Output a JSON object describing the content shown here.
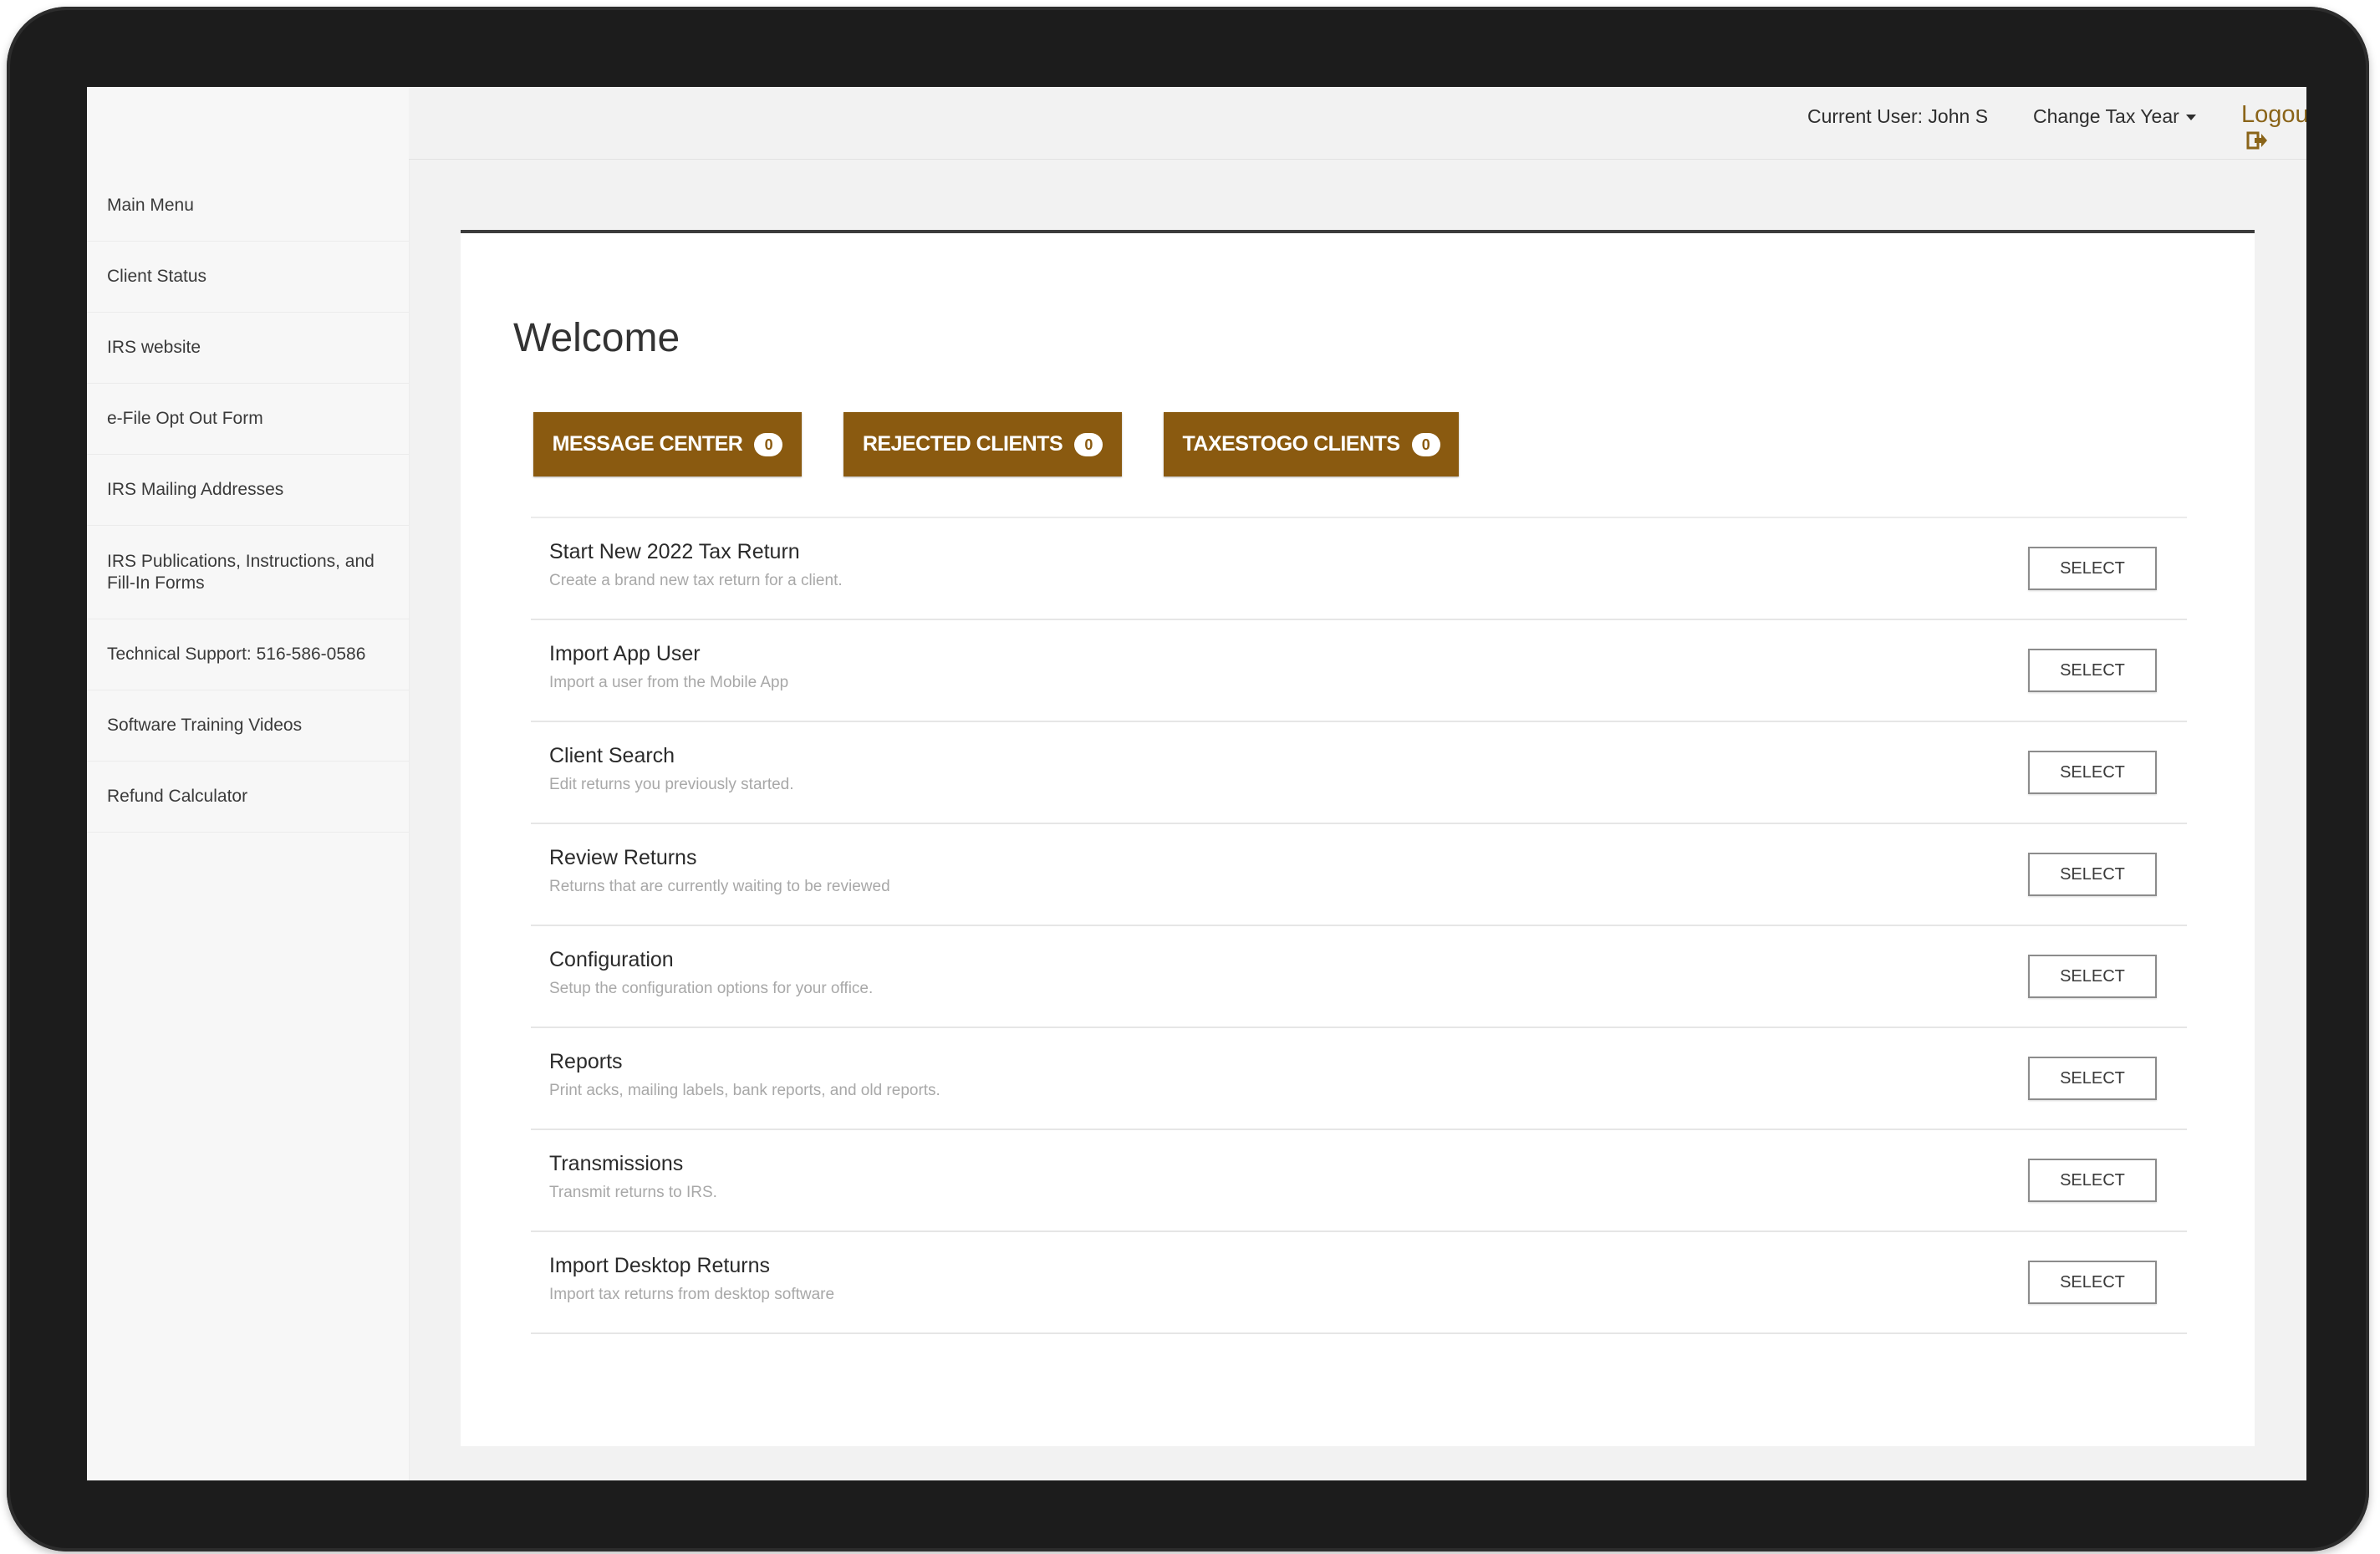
{
  "sidebar": {
    "items": [
      {
        "label": "Main Menu"
      },
      {
        "label": "Client Status"
      },
      {
        "label": "IRS website"
      },
      {
        "label": "e-File Opt Out Form"
      },
      {
        "label": "IRS Mailing Addresses"
      },
      {
        "label": "IRS Publications, Instructions, and Fill-In Forms"
      },
      {
        "label": "Technical Support: 516-586-0586"
      },
      {
        "label": "Software Training Videos"
      },
      {
        "label": "Refund Calculator"
      }
    ]
  },
  "header": {
    "current_user": "Current User: John S",
    "change_tax_year": "Change Tax Year",
    "logout": "Logout"
  },
  "main": {
    "title": "Welcome",
    "action_buttons": [
      {
        "label": "MESSAGE CENTER",
        "count": "0"
      },
      {
        "label": "REJECTED CLIENTS",
        "count": "0"
      },
      {
        "label": "TAXESTOGO CLIENTS",
        "count": "0"
      }
    ],
    "menu_rows": [
      {
        "title": "Start New 2022 Tax Return",
        "desc": "Create a brand new tax return for a client.",
        "button": "SELECT"
      },
      {
        "title": "Import App User",
        "desc": "Import a user from the Mobile App",
        "button": "SELECT"
      },
      {
        "title": "Client Search",
        "desc": "Edit returns you previously started.",
        "button": "SELECT"
      },
      {
        "title": "Review Returns",
        "desc": "Returns that are currently waiting to be reviewed",
        "button": "SELECT"
      },
      {
        "title": "Configuration",
        "desc": "Setup the configuration options for your office.",
        "button": "SELECT"
      },
      {
        "title": "Reports",
        "desc": "Print acks, mailing labels, bank reports, and old reports.",
        "button": "SELECT"
      },
      {
        "title": "Transmissions",
        "desc": "Transmit returns to IRS.",
        "button": "SELECT"
      },
      {
        "title": "Import Desktop Returns",
        "desc": "Import tax returns from desktop software",
        "button": "SELECT"
      }
    ]
  },
  "colors": {
    "accent_brown": "#8a5a10",
    "logout_text": "#8a6419"
  }
}
